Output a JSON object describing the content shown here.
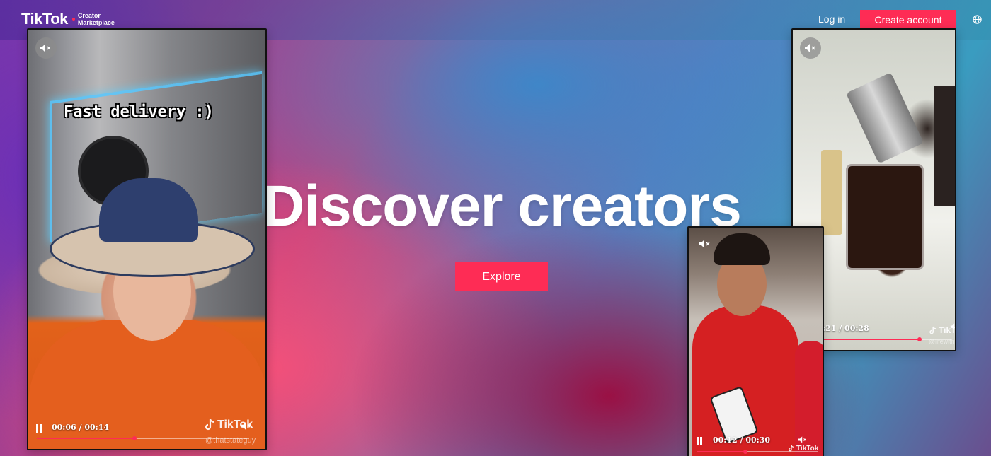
{
  "header": {
    "logo_word": "TikTok",
    "logo_sub_line1": "Creator",
    "logo_sub_line2": "Marketplace",
    "login_label": "Log in",
    "create_account_label": "Create account",
    "globe_icon": "globe-icon"
  },
  "hero": {
    "title": "Discover creators",
    "explore_label": "Explore"
  },
  "videos": [
    {
      "caption": "Fast delivery :)",
      "time": "00:06 / 00:14",
      "progress": 0.46,
      "watermark": "TikTok",
      "handle": "@thatstateguy"
    },
    {
      "time": ":21 / 00:28",
      "progress": 0.75,
      "watermark": "TikTok",
      "handle": "@lifewithtuyen"
    },
    {
      "time": "00:12 / 00:30",
      "progress": 0.4,
      "watermark": "TikTok"
    }
  ],
  "colors": {
    "accent": "#fe2c55"
  }
}
